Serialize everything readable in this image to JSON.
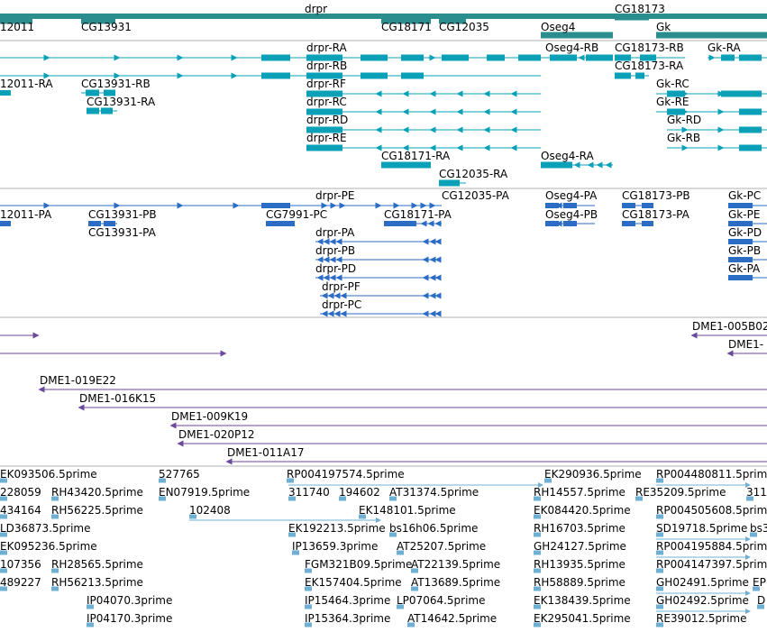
{
  "colors": {
    "gene": "#2a8e8e",
    "transcript": "#0aa0b8",
    "protein": "#2b6cc4",
    "clone": "#6a4a9a",
    "est": "#6fafd4",
    "separator": "#b0b0b0"
  },
  "gene_track": {
    "genes": [
      {
        "label": "12011",
        "class": "gene"
      },
      {
        "label": "CG13931",
        "class": "gene"
      },
      {
        "label": "drpr",
        "class": "gene"
      },
      {
        "label": "CG18171",
        "class": "gene"
      },
      {
        "label": "CG12035",
        "class": "gene"
      },
      {
        "label": "Oseg4",
        "class": "gene"
      },
      {
        "label": "CG18173",
        "class": "gene"
      },
      {
        "label": "Gk",
        "class": "gene"
      }
    ]
  },
  "transcript_track": {
    "transcripts": [
      {
        "label": "drpr-RA"
      },
      {
        "label": "Oseg4-RB"
      },
      {
        "label": "CG18173-RB"
      },
      {
        "label": "Gk-RA"
      },
      {
        "label": "drpr-RB"
      },
      {
        "label": "CG18173-RA"
      },
      {
        "label": "12011-RA"
      },
      {
        "label": "CG13931-RB"
      },
      {
        "label": "drpr-RF"
      },
      {
        "label": "Gk-RC"
      },
      {
        "label": "CG13931-RA"
      },
      {
        "label": "drpr-RC"
      },
      {
        "label": "Gk-RE"
      },
      {
        "label": "drpr-RD"
      },
      {
        "label": "Gk-RD"
      },
      {
        "label": "drpr-RE"
      },
      {
        "label": "Gk-RB"
      },
      {
        "label": "CG18171-RA"
      },
      {
        "label": "Oseg4-RA"
      },
      {
        "label": "CG12035-RA"
      }
    ]
  },
  "protein_track": {
    "proteins": [
      {
        "label": "drpr-PE"
      },
      {
        "label": "CG12035-PA"
      },
      {
        "label": "Oseg4-PA"
      },
      {
        "label": "CG18173-PB"
      },
      {
        "label": "Gk-PC"
      },
      {
        "label": "12011-PA"
      },
      {
        "label": "CG13931-PB"
      },
      {
        "label": "CG7991-PC"
      },
      {
        "label": "CG18171-PA"
      },
      {
        "label": "Oseg4-PB"
      },
      {
        "label": "CG18173-PA"
      },
      {
        "label": "Gk-PE"
      },
      {
        "label": "CG13931-PA"
      },
      {
        "label": "drpr-PA"
      },
      {
        "label": "Gk-PD"
      },
      {
        "label": "drpr-PB"
      },
      {
        "label": "Gk-PB"
      },
      {
        "label": "drpr-PD"
      },
      {
        "label": "Gk-PA"
      },
      {
        "label": "drpr-PF"
      },
      {
        "label": "drpr-PC"
      }
    ]
  },
  "clone_track": {
    "clones": [
      {
        "label": "DME1-005B02"
      },
      {
        "label": "DME1-"
      },
      {
        "label": "DME1-019E22"
      },
      {
        "label": "DME1-016K15"
      },
      {
        "label": "DME1-009K19"
      },
      {
        "label": "DME1-020P12"
      },
      {
        "label": "DME1-011A17"
      }
    ]
  },
  "est_track": {
    "ests": [
      {
        "label": "EK093506.5prime"
      },
      {
        "label": "527765"
      },
      {
        "label": "RP004197574.5prime"
      },
      {
        "label": "EK290936.5prime"
      },
      {
        "label": "RP004480811.5prime"
      },
      {
        "label": "228059"
      },
      {
        "label": "RH43420.5prime"
      },
      {
        "label": "EN07919.5prime"
      },
      {
        "label": "311740"
      },
      {
        "label": "194602"
      },
      {
        "label": "AT31374.5prime"
      },
      {
        "label": "RH14557.5prime"
      },
      {
        "label": "RE35209.5prime"
      },
      {
        "label": "311"
      },
      {
        "label": "434164"
      },
      {
        "label": "RH56225.5prime"
      },
      {
        "label": "102408"
      },
      {
        "label": "EK148101.5prime"
      },
      {
        "label": "EK084420.5prime"
      },
      {
        "label": "RP004505608.5prime"
      },
      {
        "label": "LD36873.5prime"
      },
      {
        "label": "EK192213.5prime"
      },
      {
        "label": "bs16h06.5prime"
      },
      {
        "label": "RH16703.5prime"
      },
      {
        "label": "SD19718.5prime"
      },
      {
        "label": "bs3"
      },
      {
        "label": "EK095236.5prime"
      },
      {
        "label": "IP13659.3prime"
      },
      {
        "label": "AT25207.5prime"
      },
      {
        "label": "GH24127.5prime"
      },
      {
        "label": "RP004195884.5prime"
      },
      {
        "label": "107356"
      },
      {
        "label": "RH28565.5prime"
      },
      {
        "label": "FGM321B09.5prime"
      },
      {
        "label": "AT22139.5prime"
      },
      {
        "label": "RH13935.5prime"
      },
      {
        "label": "RP004147397.5prime"
      },
      {
        "label": "489227"
      },
      {
        "label": "RH56213.5prime"
      },
      {
        "label": "EK157404.5prime"
      },
      {
        "label": "AT13689.5prime"
      },
      {
        "label": "RH58889.5prime"
      },
      {
        "label": "GH02491.5prime"
      },
      {
        "label": "EP"
      },
      {
        "label": "IP04070.3prime"
      },
      {
        "label": "IP15464.3prime"
      },
      {
        "label": "LP07064.5prime"
      },
      {
        "label": "EK138439.5prime"
      },
      {
        "label": "GH02492.5prime"
      },
      {
        "label": "D"
      },
      {
        "label": "IP04170.3prime"
      },
      {
        "label": "IP15364.3prime"
      },
      {
        "label": "AT14642.5prime"
      },
      {
        "label": "EK295041.5prime"
      },
      {
        "label": "RE39012.5prime"
      }
    ]
  }
}
